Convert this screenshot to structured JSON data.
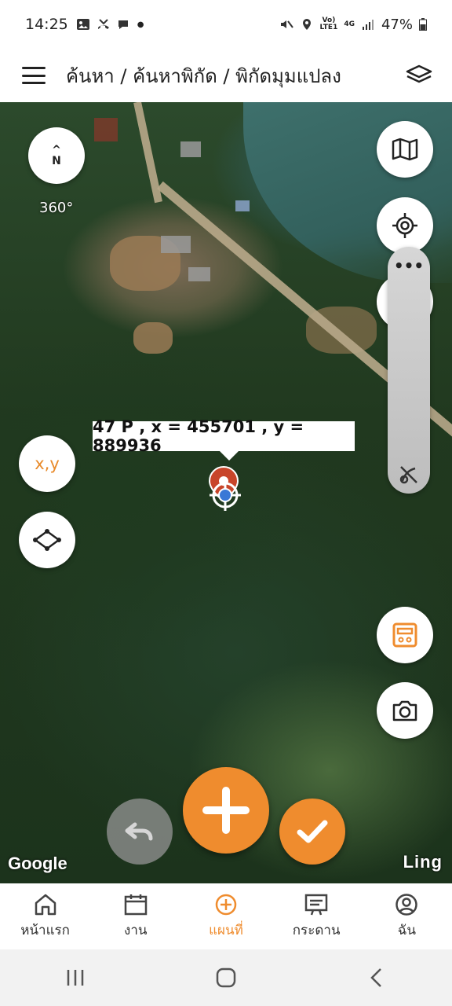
{
  "status_bar": {
    "time": "14:25",
    "signal_label_top": "Vo)",
    "signal_label_bottom": "LTE1",
    "network": "4G",
    "battery": "47%"
  },
  "header": {
    "breadcrumb": "ค้นหา / ค้นหาพิกัด / พิกัดมุมแปลง"
  },
  "map": {
    "compass_letter": "N",
    "rotation_label": "360°",
    "coordinate_label": "47 P , x = 455701 , y = 889936",
    "xy_button_label": "x,y",
    "slider_dots": "•••",
    "google_logo": "Google",
    "ling_logo": "Ling"
  },
  "bottom_nav": {
    "items": [
      {
        "label": "หน้าแรก",
        "icon": "home-icon"
      },
      {
        "label": "งาน",
        "icon": "calendar-icon"
      },
      {
        "label": "แผนที่",
        "icon": "add-circle-icon"
      },
      {
        "label": "กระดาน",
        "icon": "board-icon"
      },
      {
        "label": "ฉัน",
        "icon": "user-icon"
      }
    ],
    "active_index": 2
  },
  "colors": {
    "accent": "#ef8c2e"
  }
}
